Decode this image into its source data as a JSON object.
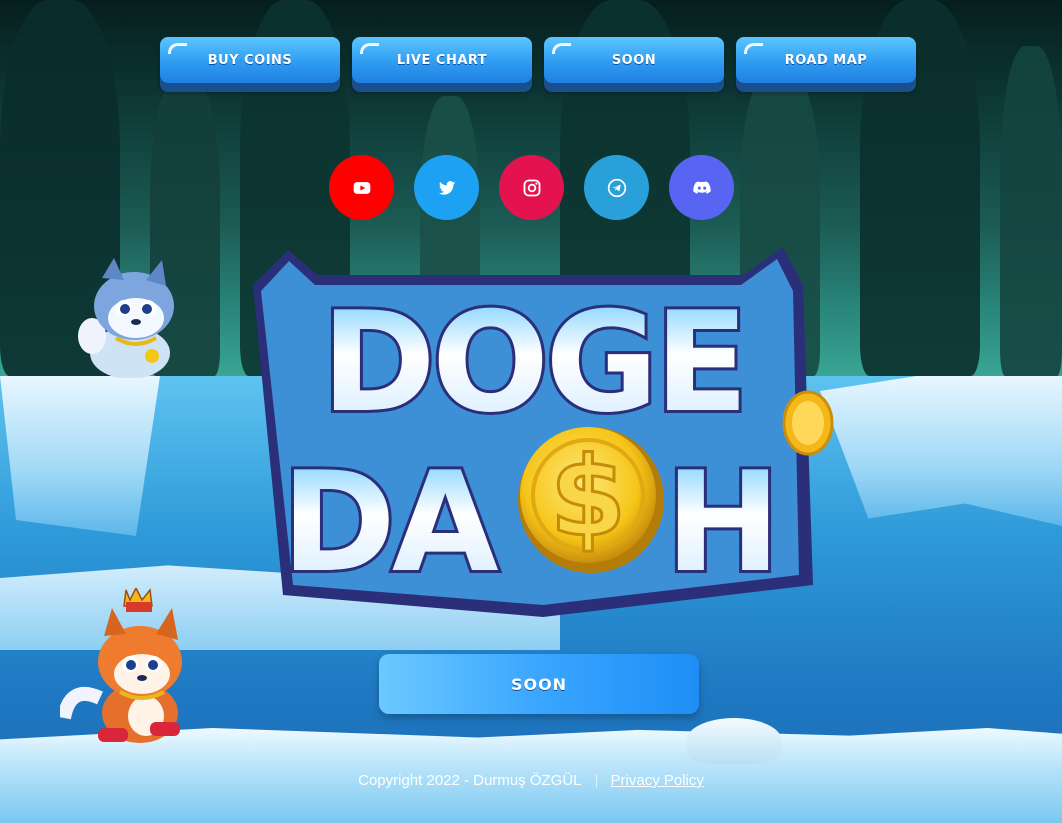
{
  "nav": {
    "items": [
      {
        "label": "BUY COINS"
      },
      {
        "label": "LIVE CHART"
      },
      {
        "label": "SOON"
      },
      {
        "label": "ROAD MAP"
      }
    ]
  },
  "socials": [
    {
      "icon": "youtube-icon",
      "color": "#ff0000"
    },
    {
      "icon": "twitter-icon",
      "color": "#1da1f2"
    },
    {
      "icon": "instagram-icon",
      "color": "#e4134f"
    },
    {
      "icon": "telegram-icon",
      "color": "#2aa0da"
    },
    {
      "icon": "discord-icon",
      "color": "#5865f2"
    }
  ],
  "logo": {
    "line1": "DOGE",
    "line2a": "DA",
    "line2b": "H",
    "coin_symbol": "$"
  },
  "main_button": {
    "label": "SOON"
  },
  "footer": {
    "copyright": "Copyright 2022 - Durmuş ÖZGÜL",
    "privacy": "Privacy Policy"
  },
  "colors": {
    "nav_button": "#2f9cf2",
    "nav_shadow": "#1a4f8f",
    "logo_outline": "#2b2f7a",
    "coin": "#f5c518"
  }
}
